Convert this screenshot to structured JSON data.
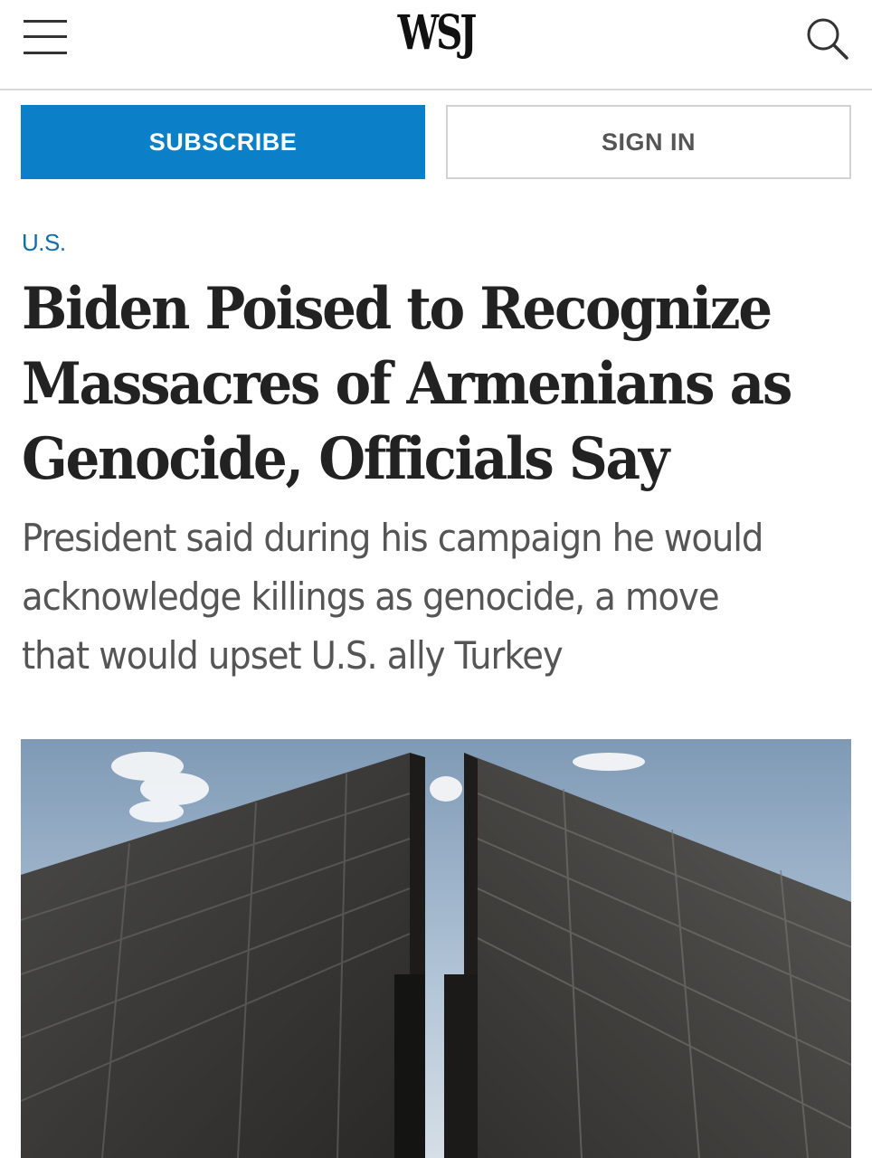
{
  "header": {
    "logo": "WSJ",
    "menu_icon": "hamburger-menu-icon",
    "search_icon": "search-icon"
  },
  "auth": {
    "subscribe_label": "SUBSCRIBE",
    "signin_label": "SIGN IN"
  },
  "article": {
    "section": "U.S.",
    "headline_lines": [
      "Biden Poised to Recognize",
      "Massacres of Armenians as",
      "Genocide, Officials Say"
    ],
    "dek_lines": [
      "President said during his campaign he would",
      "acknowledge killings as genocide, a move",
      "that would upset U.S. ally Turkey"
    ]
  },
  "colors": {
    "subscribe_bg": "#0b80c8",
    "section_link": "#0b6fb0",
    "headline": "#222222",
    "dek": "#555555"
  }
}
